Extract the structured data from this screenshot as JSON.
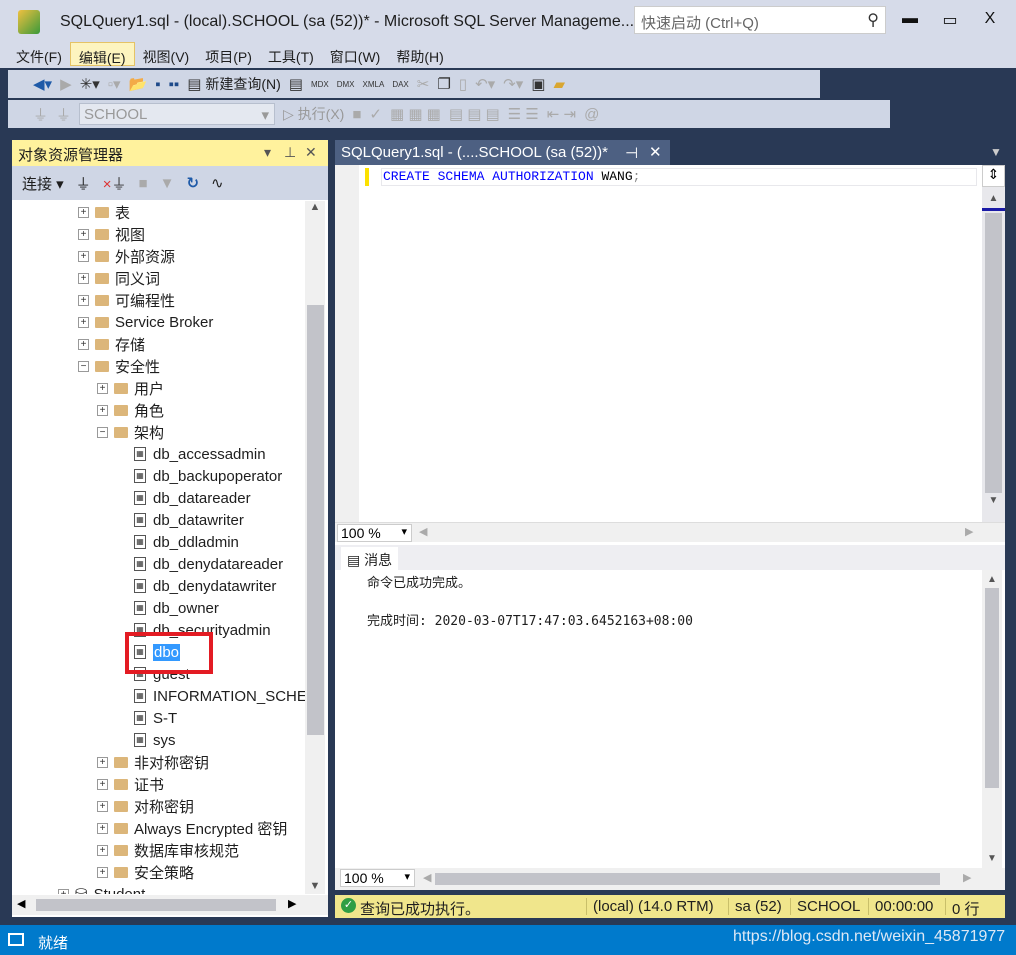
{
  "window": {
    "title": "SQLQuery1.sql - (local).SCHOOL (sa (52))* - Microsoft SQL Server Manageme...",
    "quick_launch_placeholder": "快速启动 (Ctrl+Q)",
    "minimize": "▬",
    "maximize": "▭",
    "close": "X"
  },
  "menu": [
    "文件(F)",
    "编辑(E)",
    "视图(V)",
    "项目(P)",
    "工具(T)",
    "窗口(W)",
    "帮助(H)"
  ],
  "toolbar": {
    "new_query": "新建查询(N)",
    "database": "SCHOOL",
    "execute": "执行(X)",
    "mdx": "MDX",
    "dmx": "DMX",
    "xmla": "XMLA",
    "dax": "DAX"
  },
  "object_explorer": {
    "title": "对象资源管理器",
    "connect": "连接",
    "tree": [
      {
        "label": "表",
        "type": "folder",
        "state": "+"
      },
      {
        "label": "视图",
        "type": "folder",
        "state": "+"
      },
      {
        "label": "外部资源",
        "type": "folder",
        "state": "+"
      },
      {
        "label": "同义词",
        "type": "folder",
        "state": "+"
      },
      {
        "label": "可编程性",
        "type": "folder",
        "state": "+"
      },
      {
        "label": "Service Broker",
        "type": "folder",
        "state": "+"
      },
      {
        "label": "存储",
        "type": "folder",
        "state": "+"
      },
      {
        "label": "安全性",
        "type": "folder",
        "state": "-",
        "children": [
          {
            "label": "用户",
            "type": "folder",
            "state": "+"
          },
          {
            "label": "角色",
            "type": "folder",
            "state": "+"
          },
          {
            "label": "架构",
            "type": "folder",
            "state": "-",
            "children": [
              {
                "label": "db_accessadmin",
                "type": "schema"
              },
              {
                "label": "db_backupoperator",
                "type": "schema"
              },
              {
                "label": "db_datareader",
                "type": "schema"
              },
              {
                "label": "db_datawriter",
                "type": "schema"
              },
              {
                "label": "db_ddladmin",
                "type": "schema"
              },
              {
                "label": "db_denydatareader",
                "type": "schema"
              },
              {
                "label": "db_denydatawriter",
                "type": "schema"
              },
              {
                "label": "db_owner",
                "type": "schema"
              },
              {
                "label": "db_securityadmin",
                "type": "schema"
              },
              {
                "label": "dbo",
                "type": "schema",
                "selected": true
              },
              {
                "label": "guest",
                "type": "schema"
              },
              {
                "label": "INFORMATION_SCHEMA",
                "type": "schema"
              },
              {
                "label": "S-T",
                "type": "schema"
              },
              {
                "label": "sys",
                "type": "schema"
              }
            ]
          },
          {
            "label": "非对称密钥",
            "type": "folder",
            "state": "+"
          },
          {
            "label": "证书",
            "type": "folder",
            "state": "+"
          },
          {
            "label": "对称密钥",
            "type": "folder",
            "state": "+"
          },
          {
            "label": "Always Encrypted 密钥",
            "type": "folder",
            "state": "+"
          },
          {
            "label": "数据库审核规范",
            "type": "folder",
            "state": "+"
          },
          {
            "label": "安全策略",
            "type": "folder",
            "state": "+"
          }
        ]
      }
    ],
    "next_database": "Student"
  },
  "editor": {
    "tab_title": "SQLQuery1.sql - (....SCHOOL (sa (52))*",
    "code_keywords": "CREATE SCHEMA AUTHORIZATION",
    "code_ident": "WANG",
    "code_end": ";",
    "zoom": "100 %"
  },
  "results": {
    "tab": "消息",
    "line1": "命令已成功完成。",
    "line2": "完成时间: 2020-03-07T17:47:03.6452163+08:00",
    "zoom": "100 %"
  },
  "query_status": {
    "message": "查询已成功执行。",
    "server": "(local) (14.0 RTM)",
    "user": "sa (52)",
    "database": "SCHOOL",
    "elapsed": "00:00:00",
    "rows": "0 行"
  },
  "statusbar": {
    "text": "就绪",
    "watermark": "https://blog.csdn.net/weixin_45871977"
  }
}
